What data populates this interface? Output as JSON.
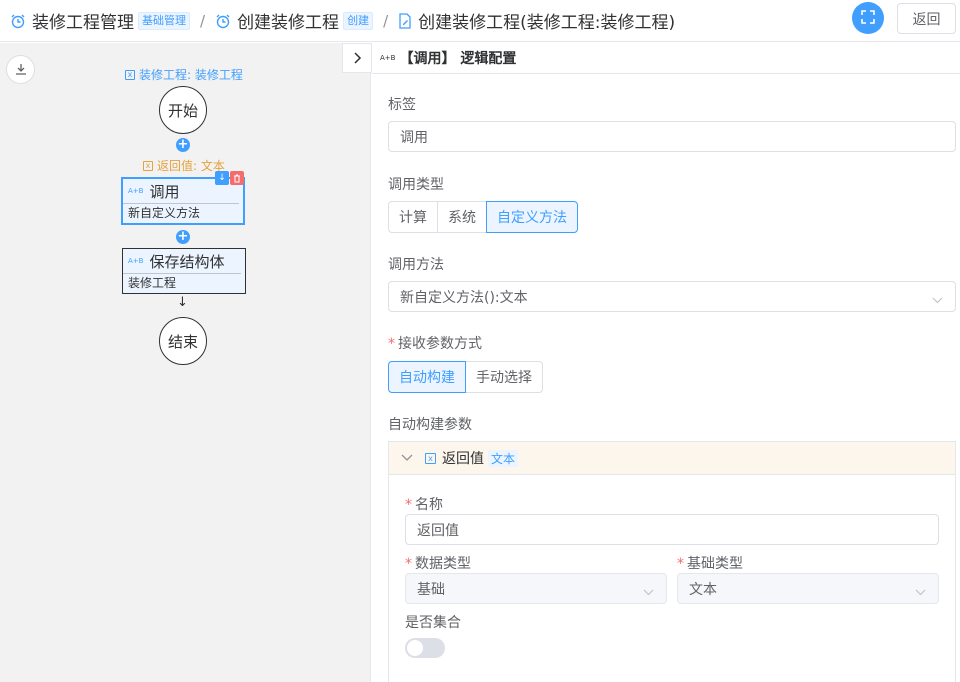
{
  "header": {
    "crumb1": {
      "title": "装修工程管理",
      "tag": "基础管理"
    },
    "crumb2": {
      "title": "创建装修工程",
      "tag": "创建"
    },
    "crumb3": {
      "title": "创建装修工程(装修工程:装修工程)"
    },
    "separator": "/",
    "back_label": "返回"
  },
  "canvas": {
    "entity_var": "装修工程: 装修工程",
    "start_label": "开始",
    "return_var": "返回值: 文本",
    "node1": {
      "badge": "A+B",
      "title": "调用",
      "sub": "新自定义方法"
    },
    "node2": {
      "badge": "A+B",
      "title": "保存结构体",
      "sub": "装修工程"
    },
    "end_label": "结束",
    "plus": "+",
    "arrow": "↓"
  },
  "panel": {
    "badge": "A+B",
    "title": "【调用】 逻辑配置",
    "label_field": {
      "label": "标签",
      "value": "调用"
    },
    "call_type": {
      "label": "调用类型",
      "options": [
        "计算",
        "系统",
        "自定义方法"
      ],
      "selected": "自定义方法"
    },
    "call_method": {
      "label": "调用方法",
      "value": "新自定义方法():文本"
    },
    "receive_mode": {
      "label": "接收参数方式",
      "required": "*",
      "options": [
        "自动构建",
        "手动选择"
      ],
      "selected": "自动构建"
    },
    "auto_params_label": "自动构建参数",
    "param_card": {
      "name": "返回值",
      "type_tag": "文本",
      "name_field": {
        "label": "名称",
        "value": "返回值"
      },
      "data_type": {
        "label": "数据类型",
        "value": "基础"
      },
      "base_type": {
        "label": "基础类型",
        "value": "文本"
      },
      "is_collection": {
        "label": "是否集合",
        "value": false
      }
    }
  },
  "colors": {
    "accent": "#409eff",
    "danger": "#f56c6c",
    "warning": "#e6a23c"
  }
}
